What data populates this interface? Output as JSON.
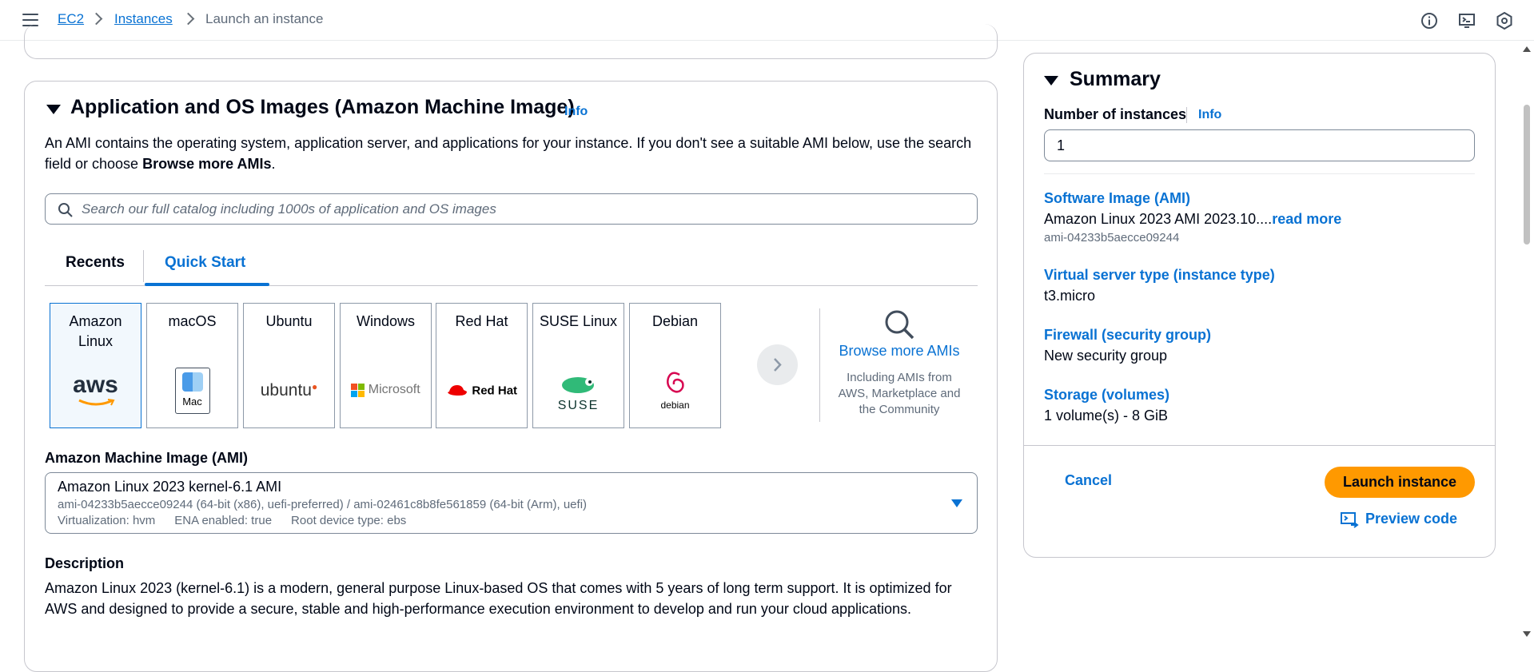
{
  "topbar": {
    "breadcrumb": [
      "EC2",
      "Instances",
      "Launch an instance"
    ],
    "icons": [
      "info-icon",
      "cloudshell-icon",
      "settings-icon"
    ]
  },
  "ami_section": {
    "title": "Application and OS Images (Amazon Machine Image)",
    "info": "Info",
    "description_prefix": "An AMI contains the operating system, application server, and applications for your instance. If you don't see a suitable AMI below, use the search field or choose ",
    "description_bold": "Browse more AMIs",
    "description_suffix": ".",
    "search_placeholder": "Search our full catalog including 1000s of application and OS images",
    "tabs": [
      "Recents",
      "Quick Start"
    ],
    "active_tab": "Quick Start",
    "os_tiles": [
      {
        "label": "Amazon Linux",
        "logo_text": "aws",
        "selected": true
      },
      {
        "label": "macOS",
        "logo_text": "Mac",
        "selected": false
      },
      {
        "label": "Ubuntu",
        "logo_text": "ubuntu",
        "selected": false
      },
      {
        "label": "Windows",
        "logo_text": "Microsoft",
        "selected": false
      },
      {
        "label": "Red Hat",
        "logo_text": "Red Hat",
        "selected": false
      },
      {
        "label": "SUSE Linux",
        "logo_text": "SUSE",
        "selected": false
      },
      {
        "label": "Debian",
        "logo_text": "debian",
        "selected": false
      }
    ],
    "browse_more": {
      "label": "Browse more AMIs",
      "sub": "Including AMIs from AWS, Marketplace and the Community"
    },
    "ami_label": "Amazon Machine Image (AMI)",
    "ami_select": {
      "name": "Amazon Linux 2023 kernel-6.1 AMI",
      "ids": "ami-04233b5aecce09244 (64-bit (x86), uefi-preferred) / ami-02461c8b8fe561859 (64-bit (Arm), uefi)",
      "virtualization": "Virtualization: hvm",
      "ena": "ENA enabled: true",
      "root_device": "Root device type: ebs"
    },
    "description_label": "Description",
    "ami_description": "Amazon Linux 2023 (kernel-6.1) is a modern, general purpose Linux-based OS that comes with 5 years of long term support. It is optimized for AWS and designed to provide a secure, stable and high-performance execution environment to develop and run your cloud applications."
  },
  "summary": {
    "title": "Summary",
    "num_instances_label": "Number of instances",
    "info": "Info",
    "num_instances_value": "1",
    "software_image_label": "Software Image (AMI)",
    "software_image_value": "Amazon Linux 2023 AMI 2023.10....",
    "read_more": "read more",
    "software_image_id": "ami-04233b5aecce09244",
    "instance_type_label": "Virtual server type (instance type)",
    "instance_type_value": "t3.micro",
    "firewall_label": "Firewall (security group)",
    "firewall_value": "New security group",
    "storage_label": "Storage (volumes)",
    "storage_value": "1 volume(s) - 8 GiB",
    "cancel": "Cancel",
    "launch": "Launch instance",
    "preview": "Preview code"
  },
  "colors": {
    "link": "#0972d3",
    "primary_button": "#ff9900",
    "text": "#000716",
    "muted": "#5f6b7a"
  }
}
